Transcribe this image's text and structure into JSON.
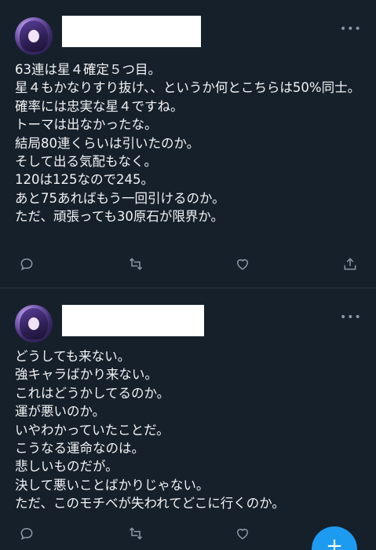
{
  "tweets": [
    {
      "more_label": "•••",
      "lines": [
        "63連は星４確定５つ目。",
        "星４もかなりすり抜け、、というか何とこちらは50%同士。",
        "確率には忠実な星４ですね。",
        "トーマは出なかったな。",
        "結局80連くらいは引いたのか。",
        "そして出る気配もなく。",
        "120は125なので245。",
        "あと75あればもう一回引けるのか。",
        "ただ、頑張っても30原石が限界か。"
      ]
    },
    {
      "more_label": "•••",
      "lines": [
        "どうしても来ない。",
        "強キャラばかり来ない。",
        "これはどうかしてるのか。",
        "運が悪いのか。",
        "いやわかっていたことだ。",
        "こうなる運命なのは。",
        "悲しいものだが。",
        "決して悪いことばかりじゃない。",
        "ただ、このモチベが失われてどこに行くのか。"
      ]
    }
  ],
  "icons": {
    "reply": "reply-icon",
    "retweet": "retweet-icon",
    "like": "heart-icon",
    "share": "share-icon",
    "compose": "compose-plus-icon"
  },
  "compose_label": "+",
  "colors": {
    "background": "#16202b",
    "text": "#f2f3f4",
    "icon": "#8b98a5",
    "accent": "#1d9bf0"
  }
}
